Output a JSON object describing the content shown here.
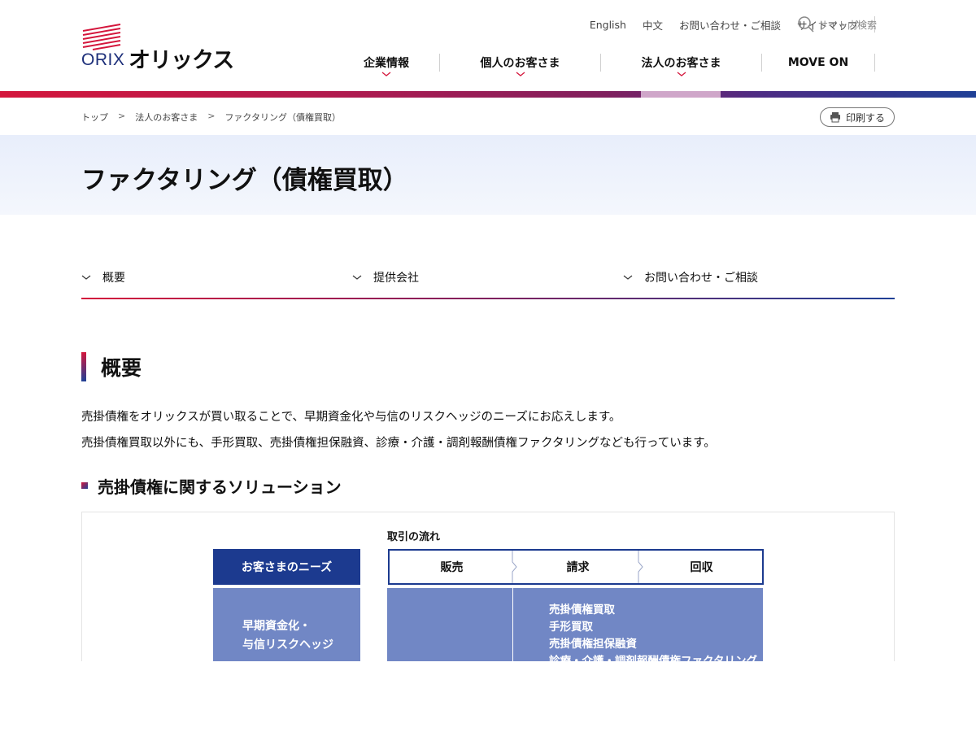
{
  "header": {
    "logo": {
      "latin": "ORIX",
      "kana": "オリックス"
    },
    "util_links": [
      "English",
      "中文",
      "お問い合わせ・ご相談",
      "サイトマップ"
    ],
    "search_placeholder": "サイト内検索",
    "global_nav": [
      "企業情報",
      "個人のお客さま",
      "法人のお客さま",
      "MOVE ON"
    ]
  },
  "colors": {
    "accent_red": "#d4163c",
    "accent_navy": "#1c3a8f",
    "diagram_blue": "#7187c5",
    "active_tab": "#cfa6c9"
  },
  "breadcrumb": [
    "トップ",
    "法人のお客さま",
    "ファクタリング（債権買取）"
  ],
  "breadcrumb_sep": ">",
  "print_label": "印刷する",
  "page_title": "ファクタリング（債権買取）",
  "anchor_tabs": [
    "概要",
    "提供会社",
    "お問い合わせ・ご相談"
  ],
  "section": {
    "heading": "概要",
    "paragraphs": [
      "売掛債権をオリックスが買い取ることで、早期資金化や与信のリスクヘッジのニーズにお応えします。",
      "売掛債権買取以外にも、手形買取、売掛債権担保融資、診療・介護・調剤報酬債権ファクタリングなども行っています。"
    ],
    "subheading": "売掛債権に関するソリューション"
  },
  "diagram": {
    "flow_label": "取引の流れ",
    "needs_header": "お客さまのニーズ",
    "needs_text": [
      "早期資金化・",
      "与信リスクヘッジ"
    ],
    "steps": [
      "販売",
      "請求",
      "回収"
    ],
    "solutions": [
      "売掛債権買取",
      "手形買取",
      "売掛債権担保融資",
      "診療・介護・調剤報酬債権ファクタリング"
    ]
  }
}
